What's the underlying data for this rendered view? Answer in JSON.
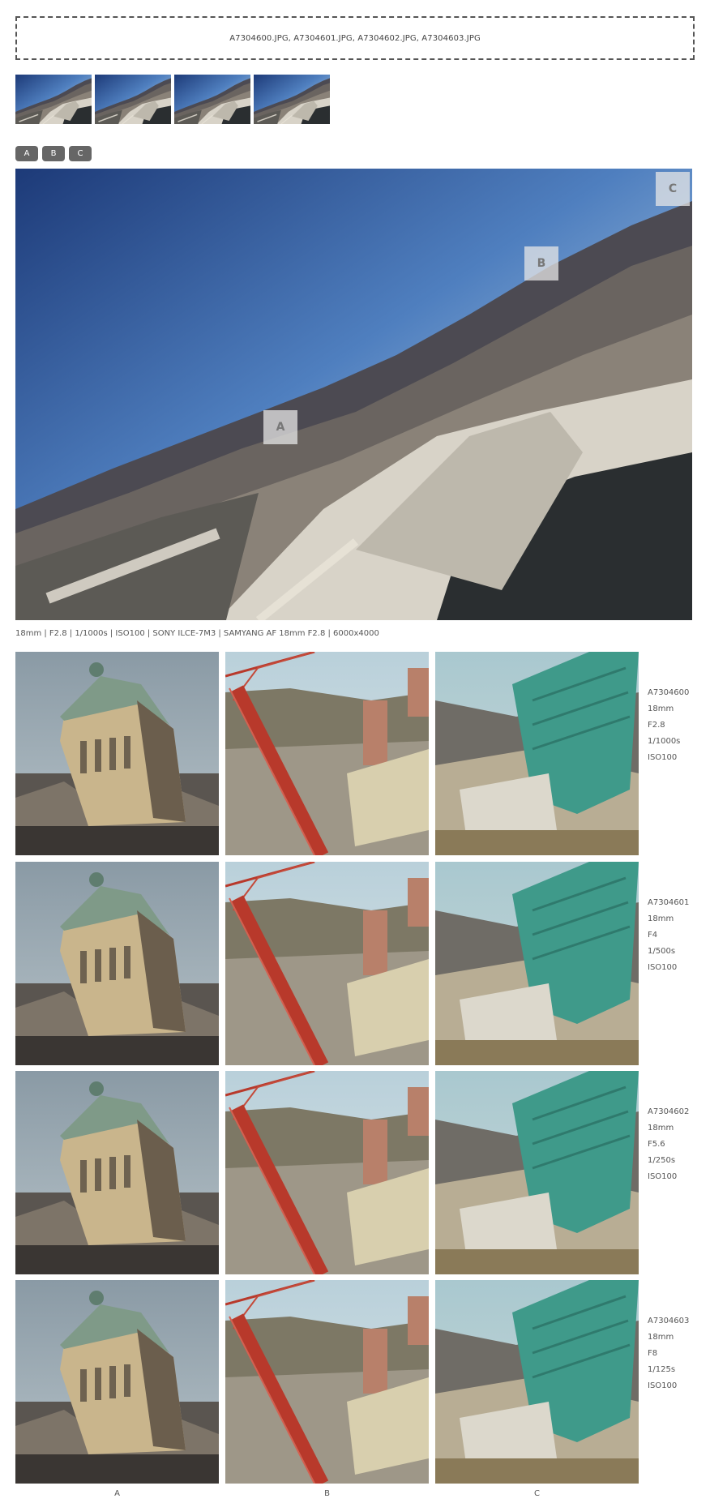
{
  "dropzone": {
    "text": "A7304600.JPG, A7304601.JPG, A7304602.JPG, A7304603.JPG"
  },
  "thumbnails": [
    "A7304600.JPG",
    "A7304601.JPG",
    "A7304602.JPG",
    "A7304603.JPG"
  ],
  "crop_buttons": {
    "a": "A",
    "b": "B",
    "c": "C"
  },
  "markers": {
    "a": "A",
    "b": "B",
    "c": "C"
  },
  "exif_line": "18mm | F2.8 | 1/1000s | ISO100 | SONY ILCE-7M3 | SAMYANG AF 18mm F2.8 | 6000x4000",
  "rows": [
    {
      "file": "A7304600",
      "focal": "18mm",
      "aperture": "F2.8",
      "shutter": "1/1000s",
      "iso": "ISO100"
    },
    {
      "file": "A7304601",
      "focal": "18mm",
      "aperture": "F4",
      "shutter": "1/500s",
      "iso": "ISO100"
    },
    {
      "file": "A7304602",
      "focal": "18mm",
      "aperture": "F5.6",
      "shutter": "1/250s",
      "iso": "ISO100"
    },
    {
      "file": "A7304603",
      "focal": "18mm",
      "aperture": "F8",
      "shutter": "1/125s",
      "iso": "ISO100"
    }
  ],
  "column_labels": {
    "a": "A",
    "b": "B",
    "c": "C"
  },
  "colors": {
    "button_bg": "#666666",
    "sky_top": "#1f3d7a",
    "sky_horizon": "#cfe0ec",
    "crane_red": "#b8392b",
    "glass_green": "#3f9a8a"
  }
}
